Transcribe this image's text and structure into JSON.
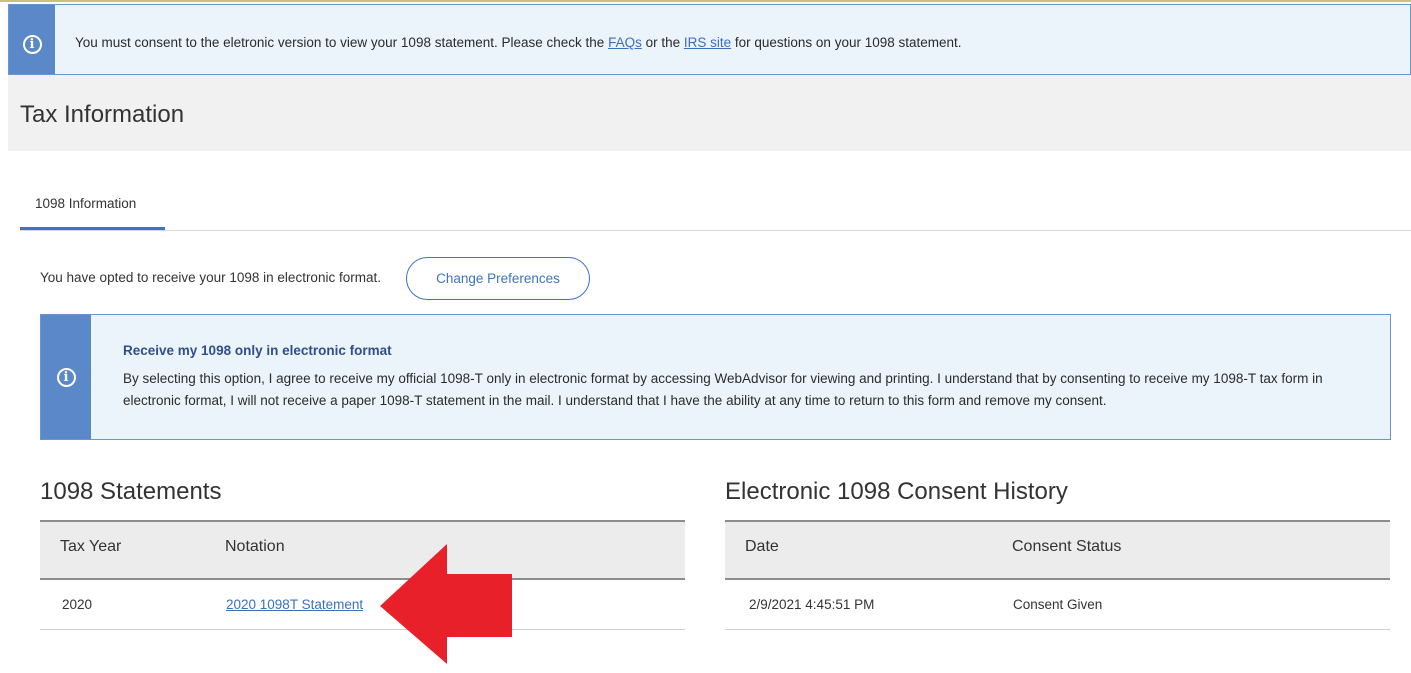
{
  "alert": {
    "text_before": "You must consent to the eletronic version to view your 1098 statement. Please check the ",
    "faq_link": "FAQs",
    "text_middle": " or the ",
    "irs_link": "IRS site",
    "text_after": " for questions on your 1098 statement."
  },
  "page": {
    "title": "Tax Information"
  },
  "tab": {
    "label": "1098 Information"
  },
  "preferences": {
    "status_text": "You have opted to receive your 1098 in electronic format.",
    "button_label": "Change Preferences"
  },
  "info_box": {
    "heading": "Receive my 1098 only in electronic format",
    "body": "By selecting this option, I agree to receive my official 1098-T only in electronic format by accessing WebAdvisor for viewing and printing. I understand that by consenting to receive my 1098-T tax form in electronic format, I will not receive a paper 1098-T statement in the mail. I understand that I have the ability at any time to return to this form and remove my consent."
  },
  "statements": {
    "title": "1098 Statements",
    "columns": [
      "Tax Year",
      "Notation"
    ],
    "rows": [
      {
        "tax_year": "2020",
        "notation": "2020 1098T Statement"
      }
    ]
  },
  "consent_history": {
    "title": "Electronic 1098 Consent History",
    "columns": [
      "Date",
      "Consent Status"
    ],
    "rows": [
      {
        "date": "2/9/2021 4:45:51 PM",
        "status": "Consent Given"
      }
    ]
  },
  "icons": {
    "info": "info-circle-icon",
    "arrow": "red-left-arrow-icon"
  },
  "colors": {
    "accent": "#3f74c2",
    "info_bar": "#5b88c8",
    "info_bg": "#ebf3fb",
    "arrow": "#e8202a"
  }
}
